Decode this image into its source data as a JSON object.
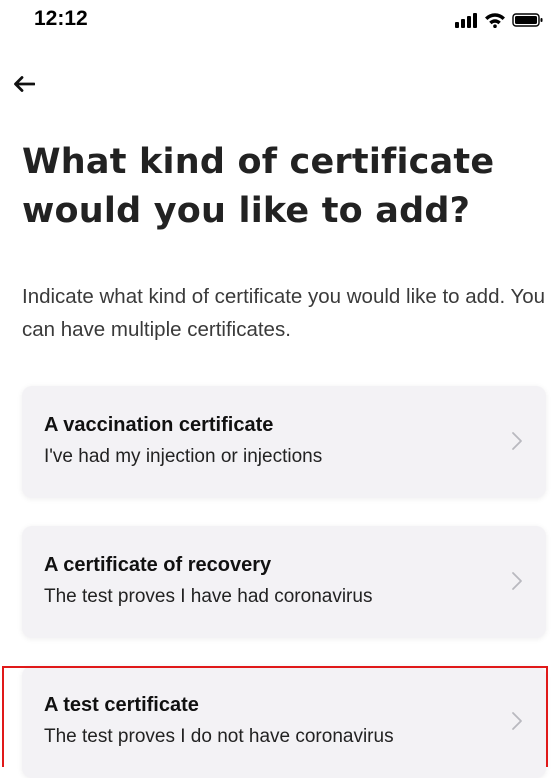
{
  "status_bar": {
    "time": "12:12",
    "icons": [
      "signal-icon",
      "wifi-icon",
      "battery-icon"
    ]
  },
  "header": {
    "back_icon": "back-arrow-icon",
    "title": "What kind of certificate would you like to add?"
  },
  "subtitle": "Indicate what kind of certificate you would like to add. You can have multiple certificates.",
  "options": [
    {
      "title": "A vaccination certificate",
      "description": "I've had my injection or injections"
    },
    {
      "title": "A certificate of recovery",
      "description": "The test proves I have had coronavirus"
    },
    {
      "title": "A test certificate",
      "description": "The test proves I do not have coronavirus",
      "highlighted": true
    }
  ],
  "colors": {
    "card_background": "#f3f2f5",
    "highlight_border": "#e01919",
    "title_text": "#222222"
  }
}
